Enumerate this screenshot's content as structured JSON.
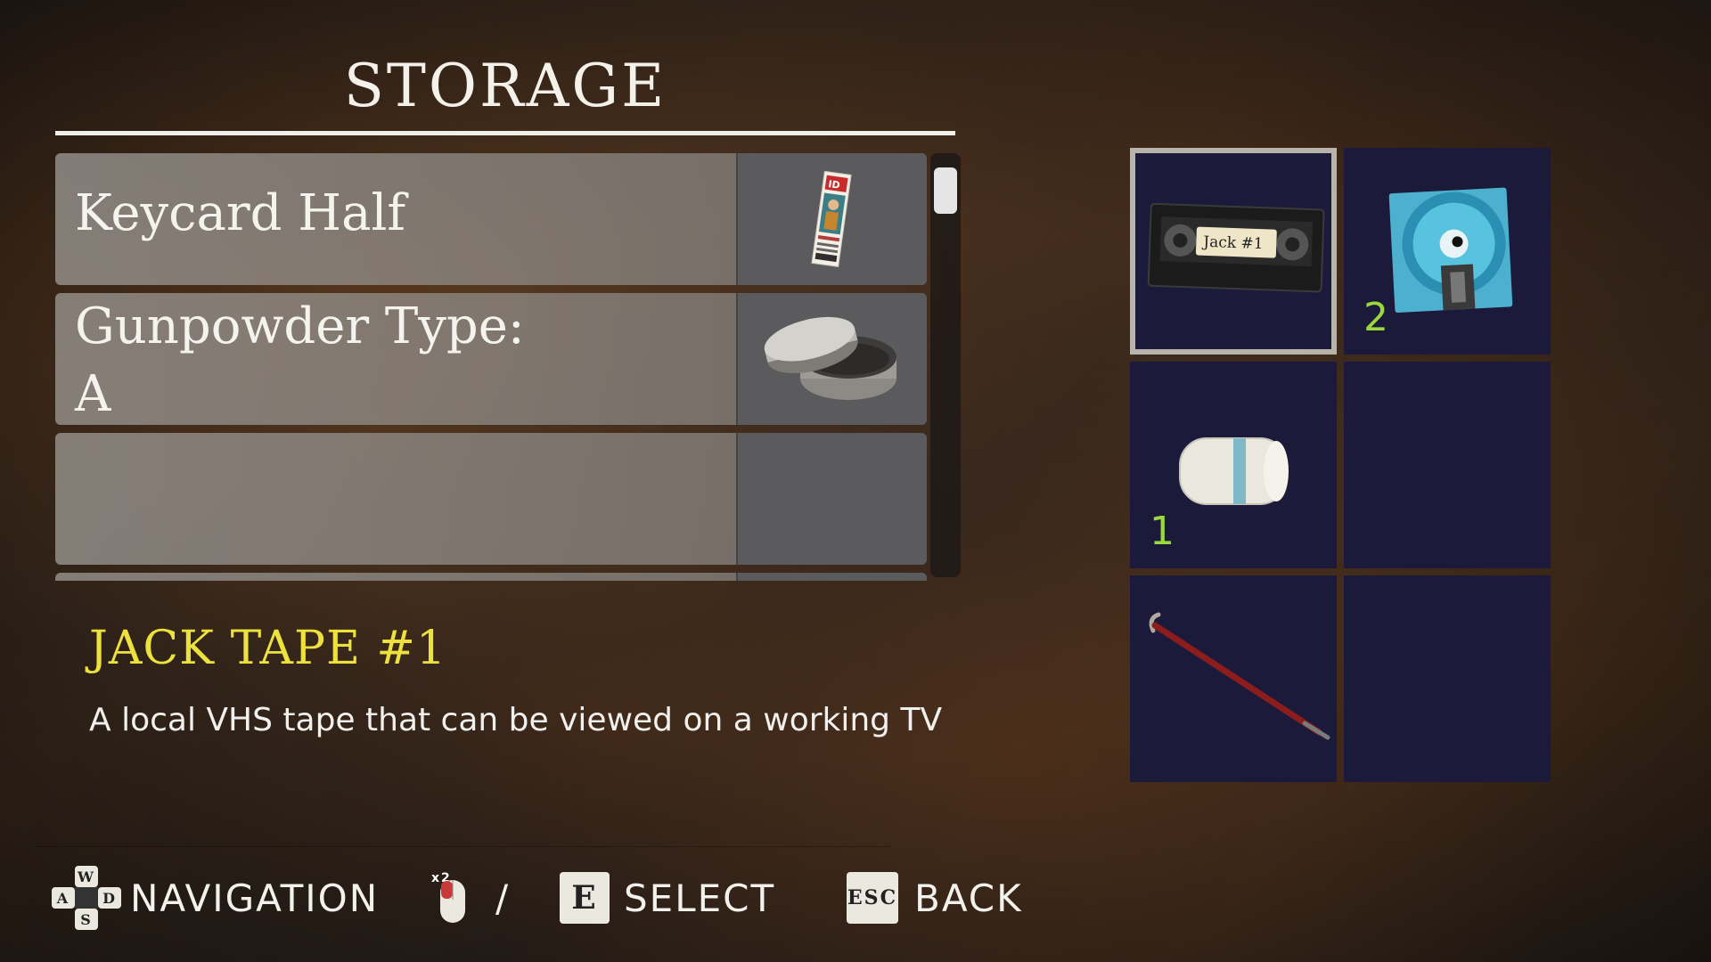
{
  "screen": {
    "title": "STORAGE"
  },
  "storage_list": {
    "items": [
      {
        "label": "Keycard Half",
        "icon": "keycard-icon"
      },
      {
        "label": "Gunpowder Type:\nA",
        "icon": "gunpowder-tin-icon"
      },
      {
        "label": "",
        "icon": ""
      }
    ]
  },
  "selected_item": {
    "name": "JACK TAPE #1",
    "description": "A local VHS tape that can be viewed on a working TV",
    "tape_label": "Jack #1"
  },
  "inventory": {
    "slots": [
      {
        "icon": "vhs-tape-icon",
        "count": "",
        "selected": true
      },
      {
        "icon": "save-disk-icon",
        "count": "2",
        "selected": false
      },
      {
        "icon": "bandage-roll-icon",
        "count": "1",
        "selected": false
      },
      {
        "icon": "",
        "count": "",
        "selected": false
      },
      {
        "icon": "crowbar-icon",
        "count": "",
        "selected": false
      },
      {
        "icon": "",
        "count": "",
        "selected": false
      }
    ]
  },
  "controls": {
    "navigation_label": "NAVIGATION",
    "wasd_keys": {
      "w": "W",
      "a": "A",
      "s": "S",
      "d": "D"
    },
    "mouse_badge": "x2",
    "separator": "/",
    "select_key": "E",
    "select_label": "SELECT",
    "back_key": "ESC",
    "back_label": "BACK"
  },
  "colors": {
    "title_accent": "#ece13d",
    "count_color": "#9ad93a",
    "slot_bg": "#1c1a3a",
    "selected_outline": "#b8b4ac"
  }
}
